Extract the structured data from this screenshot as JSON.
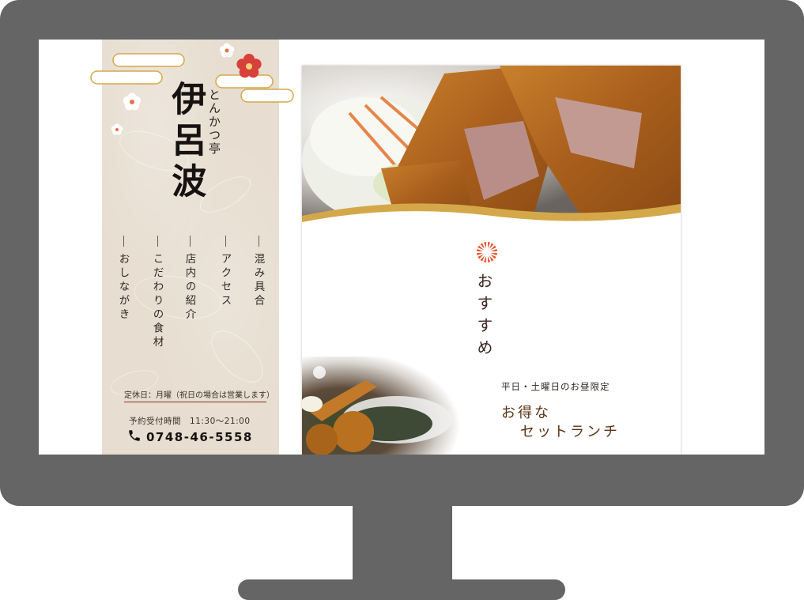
{
  "site": {
    "logo_subtitle": "とんかつ亭",
    "logo_name": "伊呂波"
  },
  "nav": [
    {
      "label": "混み具合"
    },
    {
      "label": "アクセス"
    },
    {
      "label": "店内の紹介"
    },
    {
      "label": "こだわりの食材"
    },
    {
      "label": "おしながき"
    }
  ],
  "info": {
    "holiday": "定休日：月曜（祝日の場合は営業します）",
    "hours": "予約受付時間　11:30〜21:00",
    "phone": "0748-46-5558"
  },
  "main": {
    "recommend": "おすすめ",
    "lunch_note": "平日・土曜日のお昼限定",
    "lunch_title_1": "お得な",
    "lunch_title_2": "セットランチ"
  },
  "icons": {
    "phone": "phone-icon",
    "flower": "plum-blossom-icon",
    "crest": "chrysanthemum-crest-icon"
  },
  "colors": {
    "monitor": "#666566",
    "sidebar_bg": "#e7ddd0",
    "accent_red": "#d8403a",
    "gold": "#d4a84a",
    "text_brown": "#5a3417"
  }
}
